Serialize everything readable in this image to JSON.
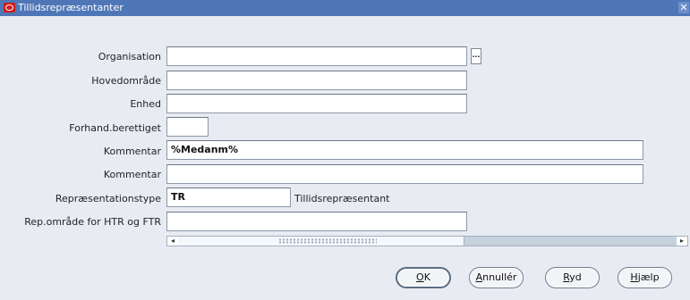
{
  "window": {
    "title": "Tillidsrepræsentanter",
    "close_glyph": "✕"
  },
  "form": {
    "organisation": {
      "label": "Organisation",
      "value": "",
      "lov_glyph": "..."
    },
    "hovedomraade": {
      "label": "Hovedområde",
      "value": ""
    },
    "enhed": {
      "label": "Enhed",
      "value": ""
    },
    "forhand_berettiget": {
      "label": "Forhand.berettiget",
      "value": ""
    },
    "kommentar1": {
      "label": "Kommentar",
      "value": "%Medanm%"
    },
    "kommentar2": {
      "label": "Kommentar",
      "value": ""
    },
    "repraesentationstype": {
      "label": "Repræsentationstype",
      "value": "TR",
      "description": "Tillidsrepræsentant"
    },
    "rep_omraade": {
      "label": "Rep.område for HTR og FTR",
      "value": ""
    }
  },
  "scrollbar": {
    "left_arrow": "◂",
    "right_arrow": "▸"
  },
  "buttons": {
    "ok": {
      "mnemonic": "O",
      "rest": "K"
    },
    "cancel": {
      "mnemonic": "A",
      "rest": "nnullér"
    },
    "clear": {
      "mnemonic": "R",
      "rest": "yd"
    },
    "help": {
      "mnemonic": "H",
      "rest": "jælp"
    }
  },
  "colors": {
    "titlebar": "#4f77b7",
    "background": "#e8ecf2"
  }
}
